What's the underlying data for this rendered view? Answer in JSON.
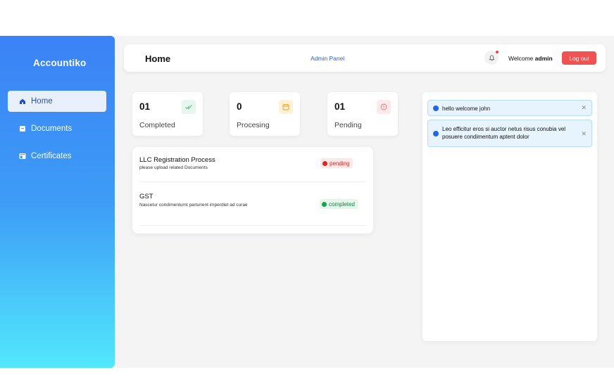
{
  "sidebar": {
    "logo": "Accountiko",
    "items": [
      {
        "label": "Home",
        "active": true
      },
      {
        "label": "Documents",
        "active": false
      },
      {
        "label": "Certificates",
        "active": false
      }
    ]
  },
  "header": {
    "title": "Home",
    "admin_link": "Admin Panel",
    "welcome_prefix": "Welcome",
    "user": "admin",
    "logout_label": "Log out"
  },
  "stats": [
    {
      "value": "01",
      "label": "Completed",
      "icon": "double-check-icon",
      "color": "#22c55e"
    },
    {
      "value": "0",
      "label": "Procesing",
      "icon": "calendar-icon",
      "color": "#f59e0b"
    },
    {
      "value": "01",
      "label": "Pending",
      "icon": "info-circle-icon",
      "color": "#f87171"
    }
  ],
  "processes": [
    {
      "title": "LLC Registration Process",
      "subtitle": "please upload related Documents",
      "status": "pending"
    },
    {
      "title": "GST",
      "subtitle": "Nascetur condimentumt parturient imperdiet ad curae",
      "status": "completed"
    }
  ],
  "notifications": [
    {
      "text": "hello welcome john"
    },
    {
      "text": "Leo efficitur eros si auctor netus risus conubia vel posuere condimentum aptent dolor"
    }
  ],
  "colors": {
    "accent": "#2563eb",
    "danger": "#f05252",
    "sidebar_top": "#3b82f6",
    "sidebar_bottom": "#52e8fc"
  }
}
